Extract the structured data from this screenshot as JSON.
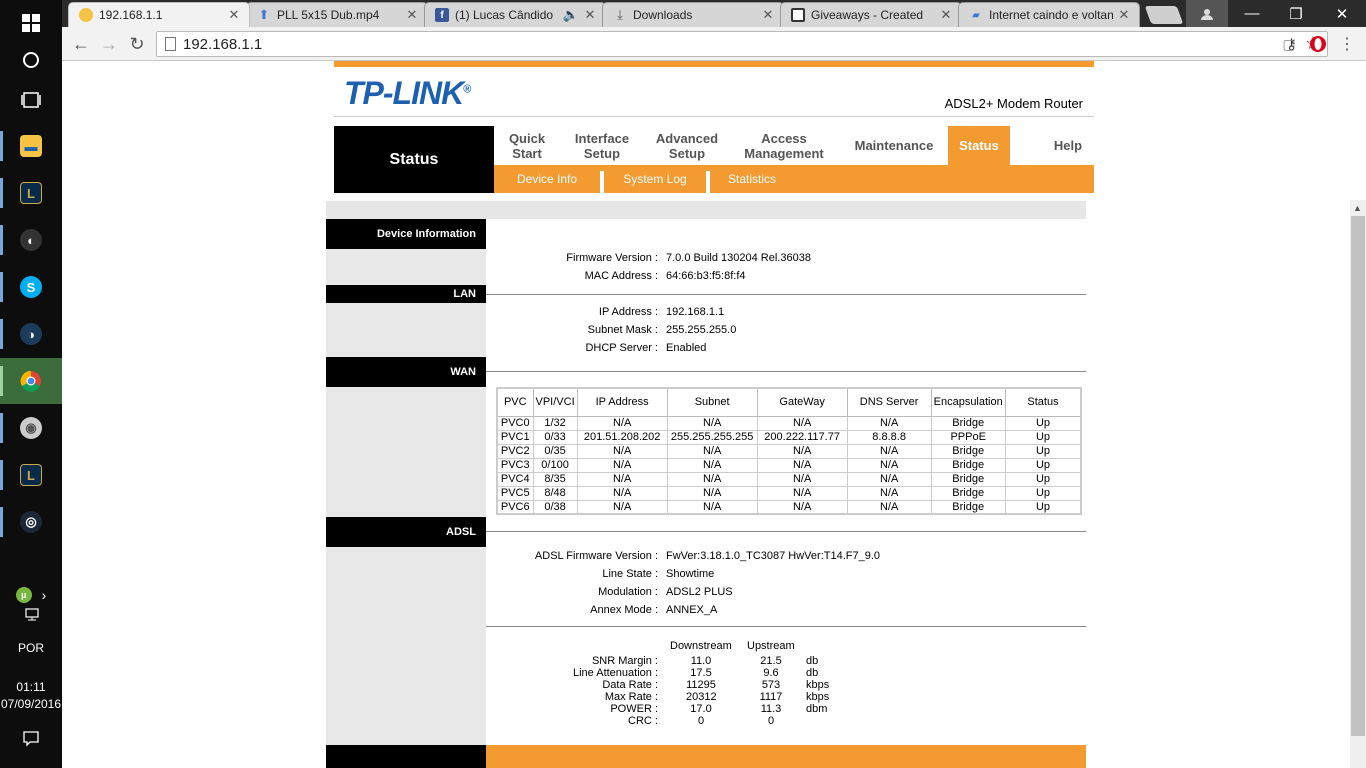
{
  "taskbar": {
    "language": "POR",
    "time": "01:11",
    "date": "07/09/2016"
  },
  "browser": {
    "tabs": [
      {
        "title": "192.168.1.1"
      },
      {
        "title": "PLL 5x15 Dub.mp4"
      },
      {
        "title": "(1) Lucas Cândido"
      },
      {
        "title": "Downloads"
      },
      {
        "title": "Giveaways - Created"
      },
      {
        "title": "Internet caindo e voltan"
      }
    ],
    "url": "192.168.1.1"
  },
  "router": {
    "brand": "TP-LINK",
    "brand_mark": "®",
    "product": "ADSL2+ Modem Router",
    "page_label": "Status",
    "menu": [
      {
        "label": "Quick Start"
      },
      {
        "label": "Interface Setup"
      },
      {
        "label": "Advanced Setup"
      },
      {
        "label": "Access Management"
      },
      {
        "label": "Maintenance"
      },
      {
        "label": "Status"
      },
      {
        "label": "Help"
      }
    ],
    "submenu": [
      {
        "label": "Device Info"
      },
      {
        "label": "System Log"
      },
      {
        "label": "Statistics"
      }
    ]
  },
  "device": {
    "section": "Device Information",
    "firmware_label": "Firmware Version :",
    "firmware": "7.0.0 Build 130204 Rel.36038",
    "mac_label": "MAC Address :",
    "mac": "64:66:b3:f5:8f:f4"
  },
  "lan": {
    "section": "LAN",
    "ip_label": "IP Address :",
    "ip": "192.168.1.1",
    "mask_label": "Subnet Mask :",
    "mask": "255.255.255.0",
    "dhcp_label": "DHCP Server :",
    "dhcp": "Enabled"
  },
  "wan": {
    "section": "WAN",
    "headers": [
      "PVC",
      "VPI/VCI",
      "IP Address",
      "Subnet",
      "GateWay",
      "DNS Server",
      "Encapsulation",
      "Status"
    ],
    "rows": [
      [
        "PVC0",
        "1/32",
        "N/A",
        "N/A",
        "N/A",
        "N/A",
        "Bridge",
        "Up"
      ],
      [
        "PVC1",
        "0/33",
        "201.51.208.202",
        "255.255.255.255",
        "200.222.117.77",
        "8.8.8.8",
        "PPPoE",
        "Up"
      ],
      [
        "PVC2",
        "0/35",
        "N/A",
        "N/A",
        "N/A",
        "N/A",
        "Bridge",
        "Up"
      ],
      [
        "PVC3",
        "0/100",
        "N/A",
        "N/A",
        "N/A",
        "N/A",
        "Bridge",
        "Up"
      ],
      [
        "PVC4",
        "8/35",
        "N/A",
        "N/A",
        "N/A",
        "N/A",
        "Bridge",
        "Up"
      ],
      [
        "PVC5",
        "8/48",
        "N/A",
        "N/A",
        "N/A",
        "N/A",
        "Bridge",
        "Up"
      ],
      [
        "PVC6",
        "0/38",
        "N/A",
        "N/A",
        "N/A",
        "N/A",
        "Bridge",
        "Up"
      ]
    ]
  },
  "adsl": {
    "section": "ADSL",
    "fw_label": "ADSL Firmware Version :",
    "fw": "FwVer:3.18.1.0_TC3087 HwVer:T14.F7_9.0",
    "line_label": "Line State :",
    "line": "Showtime",
    "mod_label": "Modulation :",
    "mod": "ADSL2 PLUS",
    "annex_label": "Annex Mode :",
    "annex": "ANNEX_A",
    "stats_header": {
      "down": "Downstream",
      "up": "Upstream"
    },
    "stats": [
      {
        "label": "SNR Margin :",
        "down": "11.0",
        "up": "21.5",
        "unit": "db"
      },
      {
        "label": "Line Attenuation :",
        "down": "17.5",
        "up": "9.6",
        "unit": "db"
      },
      {
        "label": "Data Rate :",
        "down": "11295",
        "up": "573",
        "unit": "kbps"
      },
      {
        "label": "Max Rate :",
        "down": "20312",
        "up": "1117",
        "unit": "kbps"
      },
      {
        "label": "POWER :",
        "down": "17.0",
        "up": "11.3",
        "unit": "dbm"
      },
      {
        "label": "CRC :",
        "down": "0",
        "up": "0",
        "unit": ""
      }
    ]
  },
  "colors": {
    "accent": "#f39a31",
    "brand_blue": "#1d5fb0"
  }
}
